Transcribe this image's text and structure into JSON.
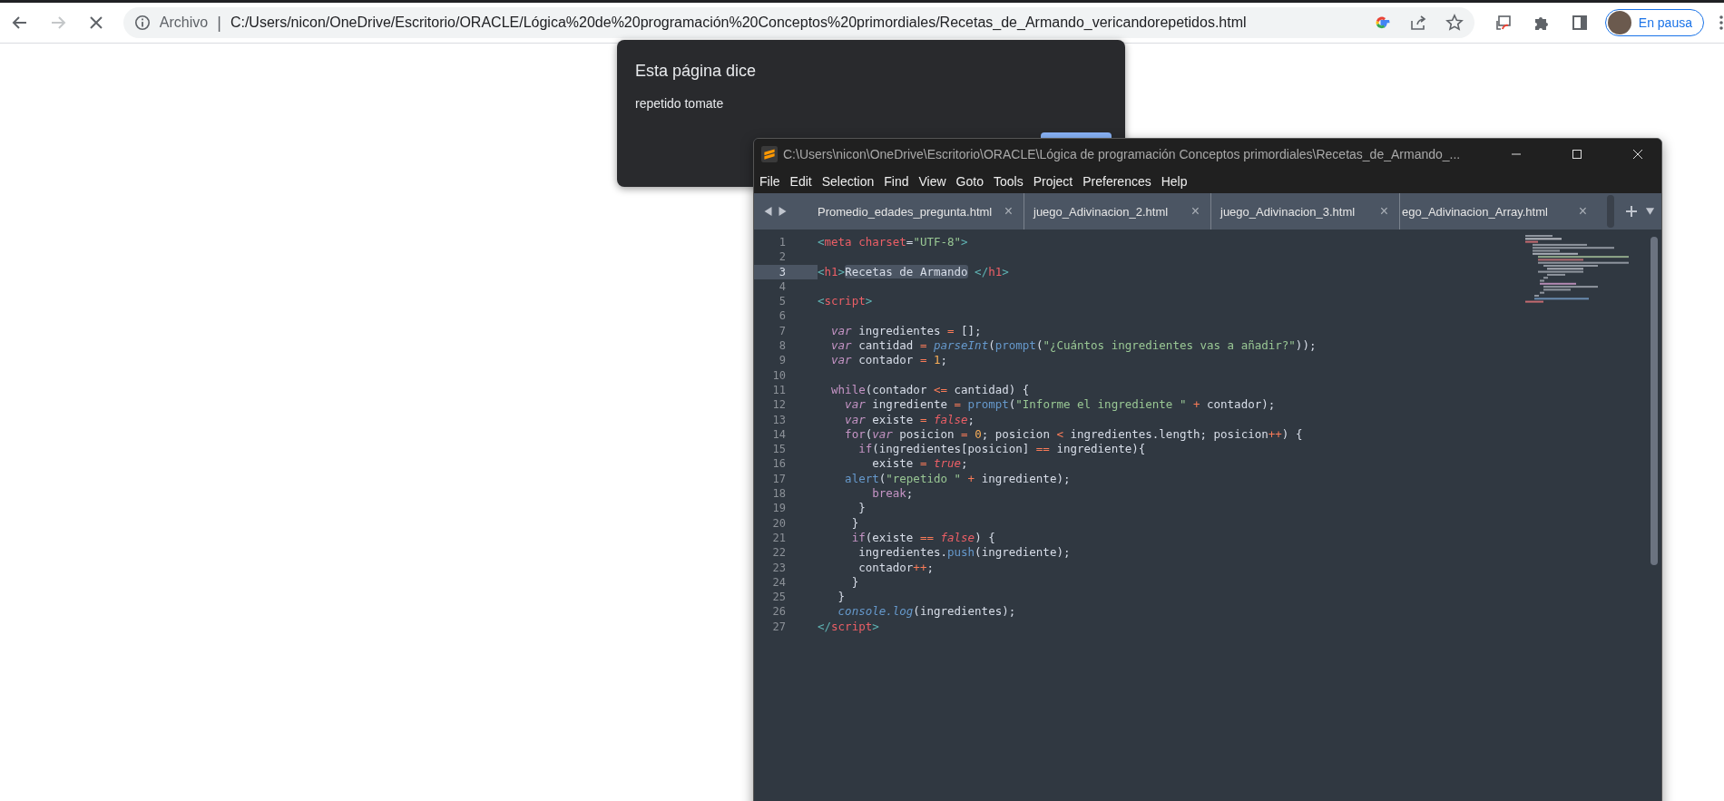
{
  "browser": {
    "forward_disabled": true,
    "omnibox": {
      "security_label": "Archivo",
      "separator": "|",
      "url": "C:/Users/nicon/OneDrive/Escritorio/ORACLE/Lógica%20de%20programación%20Conceptos%20primordiales/Recetas_de_Armando_vericandorepetidos.html"
    },
    "profile": {
      "label": "En pausa"
    }
  },
  "dialog": {
    "title": "Esta página dice",
    "message": "repetido tomate"
  },
  "editor": {
    "title": "C:\\Users\\nicon\\OneDrive\\Escritorio\\ORACLE\\Lógica de programación Conceptos primordiales\\Recetas_de_Armando_...",
    "menu": [
      "File",
      "Edit",
      "Selection",
      "Find",
      "View",
      "Goto",
      "Tools",
      "Project",
      "Preferences",
      "Help"
    ],
    "tabs": [
      {
        "label": "Promedio_edades_pregunta.html",
        "close": "×",
        "selected": false
      },
      {
        "label": "juego_Adivinacion_2.html",
        "close": "×",
        "selected": false
      },
      {
        "label": "juego_Adivinacion_3.html",
        "close": "×",
        "selected": false
      },
      {
        "label": "ego_Adivinacion_Array.html",
        "close": "×",
        "selected": false
      }
    ],
    "lines": [
      {
        "number": "1",
        "current": false,
        "tokens": [
          {
            "text": "<",
            "kind": "punct"
          },
          {
            "text": "meta",
            "kind": "tag"
          },
          {
            "text": " charset",
            "kind": "tag"
          },
          {
            "text": "=",
            "kind": "plain"
          },
          {
            "text": "\"UTF-8\"",
            "kind": "string"
          },
          {
            "text": ">",
            "kind": "punct"
          }
        ]
      },
      {
        "number": "2",
        "current": false
      },
      {
        "number": "3",
        "current": true,
        "tokens": [
          {
            "text": "<",
            "kind": "punct"
          },
          {
            "text": "h1",
            "kind": "tag"
          },
          {
            "text": ">",
            "kind": "punct"
          },
          {
            "text": "Recetas de Armando",
            "kind": "selection"
          },
          {
            "text": " </",
            "kind": "punct"
          },
          {
            "text": "h1",
            "kind": "tag"
          },
          {
            "text": ">",
            "kind": "punct"
          }
        ]
      },
      {
        "number": "4",
        "current": false
      },
      {
        "number": "5",
        "current": false,
        "tokens": [
          {
            "text": "<",
            "kind": "punct"
          },
          {
            "text": "script",
            "kind": "tag"
          },
          {
            "text": ">",
            "kind": "punct"
          }
        ]
      },
      {
        "number": "6",
        "current": false
      },
      {
        "number": "7",
        "current": false,
        "tokens": [
          {
            "text": "  var",
            "kind": "storage"
          },
          {
            "text": " ingredientes ",
            "kind": "plain"
          },
          {
            "text": "=",
            "kind": "op"
          },
          {
            "text": " [];",
            "kind": "plain"
          }
        ]
      },
      {
        "number": "8",
        "current": false,
        "tokens": [
          {
            "text": "  var",
            "kind": "storage"
          },
          {
            "text": " cantidad ",
            "kind": "plain"
          },
          {
            "text": "= ",
            "kind": "op"
          },
          {
            "text": "parseInt",
            "kind": "func-italic"
          },
          {
            "text": "(",
            "kind": "plain"
          },
          {
            "text": "prompt",
            "kind": "func"
          },
          {
            "text": "(",
            "kind": "plain"
          },
          {
            "text": "\"¿Cuántos ingredientes vas a añadir?\"",
            "kind": "string"
          },
          {
            "text": "));",
            "kind": "plain"
          }
        ]
      },
      {
        "number": "9",
        "current": false,
        "tokens": [
          {
            "text": "  var",
            "kind": "storage"
          },
          {
            "text": " contador ",
            "kind": "plain"
          },
          {
            "text": "= ",
            "kind": "op"
          },
          {
            "text": "1",
            "kind": "number"
          },
          {
            "text": ";",
            "kind": "plain"
          }
        ]
      },
      {
        "number": "10",
        "current": false
      },
      {
        "number": "11",
        "current": false,
        "tokens": [
          {
            "text": "  while",
            "kind": "keyword"
          },
          {
            "text": "(contador ",
            "kind": "plain"
          },
          {
            "text": "<=",
            "kind": "op"
          },
          {
            "text": " cantidad) {",
            "kind": "plain"
          }
        ]
      },
      {
        "number": "12",
        "current": false,
        "tokens": [
          {
            "text": "    var",
            "kind": "storage"
          },
          {
            "text": " ingrediente ",
            "kind": "plain"
          },
          {
            "text": "= ",
            "kind": "op"
          },
          {
            "text": "prompt",
            "kind": "func"
          },
          {
            "text": "(",
            "kind": "plain"
          },
          {
            "text": "\"Informe el ingrediente \" ",
            "kind": "string"
          },
          {
            "text": "+",
            "kind": "op"
          },
          {
            "text": " contador);",
            "kind": "plain"
          }
        ]
      },
      {
        "number": "13",
        "current": false,
        "tokens": [
          {
            "text": "    var",
            "kind": "storage"
          },
          {
            "text": " existe ",
            "kind": "plain"
          },
          {
            "text": "= ",
            "kind": "op"
          },
          {
            "text": "false",
            "kind": "constant"
          },
          {
            "text": ";",
            "kind": "plain"
          }
        ]
      },
      {
        "number": "14",
        "current": false,
        "tokens": [
          {
            "text": "    for",
            "kind": "keyword"
          },
          {
            "text": "(",
            "kind": "plain"
          },
          {
            "text": "var",
            "kind": "storage"
          },
          {
            "text": " posicion ",
            "kind": "plain"
          },
          {
            "text": "= ",
            "kind": "op"
          },
          {
            "text": "0",
            "kind": "number"
          },
          {
            "text": "; posicion ",
            "kind": "plain"
          },
          {
            "text": "<",
            "kind": "op"
          },
          {
            "text": " ingredientes.length; posicion",
            "kind": "plain"
          },
          {
            "text": "++",
            "kind": "op"
          },
          {
            "text": ") {",
            "kind": "plain"
          }
        ]
      },
      {
        "number": "15",
        "current": false,
        "tokens": [
          {
            "text": "      if",
            "kind": "keyword"
          },
          {
            "text": "(ingredientes[posicion] ",
            "kind": "plain"
          },
          {
            "text": "==",
            "kind": "op"
          },
          {
            "text": " ingrediente){",
            "kind": "plain"
          }
        ]
      },
      {
        "number": "16",
        "current": false,
        "tokens": [
          {
            "text": "        existe ",
            "kind": "plain"
          },
          {
            "text": "= ",
            "kind": "op"
          },
          {
            "text": "true",
            "kind": "constant"
          },
          {
            "text": ";",
            "kind": "plain"
          }
        ]
      },
      {
        "number": "17",
        "current": false,
        "tokens": [
          {
            "text": "    alert",
            "kind": "func"
          },
          {
            "text": "(",
            "kind": "plain"
          },
          {
            "text": "\"repetido \" ",
            "kind": "string"
          },
          {
            "text": "+",
            "kind": "op"
          },
          {
            "text": " ingrediente);",
            "kind": "plain"
          }
        ]
      },
      {
        "number": "18",
        "current": false,
        "tokens": [
          {
            "text": "        break",
            "kind": "keyword"
          },
          {
            "text": ";",
            "kind": "plain"
          }
        ]
      },
      {
        "number": "19",
        "current": false,
        "tokens": [
          {
            "text": "      }",
            "kind": "plain"
          }
        ]
      },
      {
        "number": "20",
        "current": false,
        "tokens": [
          {
            "text": "     }",
            "kind": "plain"
          }
        ]
      },
      {
        "number": "21",
        "current": false,
        "tokens": [
          {
            "text": "     if",
            "kind": "keyword"
          },
          {
            "text": "(existe ",
            "kind": "plain"
          },
          {
            "text": "== ",
            "kind": "op"
          },
          {
            "text": "false",
            "kind": "constant"
          },
          {
            "text": ") {",
            "kind": "plain"
          }
        ]
      },
      {
        "number": "22",
        "current": false,
        "tokens": [
          {
            "text": "      ingredientes.",
            "kind": "plain"
          },
          {
            "text": "push",
            "kind": "func"
          },
          {
            "text": "(ingrediente);",
            "kind": "plain"
          }
        ]
      },
      {
        "number": "23",
        "current": false,
        "tokens": [
          {
            "text": "      contador",
            "kind": "plain"
          },
          {
            "text": "++",
            "kind": "op"
          },
          {
            "text": ";",
            "kind": "plain"
          }
        ]
      },
      {
        "number": "24",
        "current": false,
        "tokens": [
          {
            "text": "     }",
            "kind": "plain"
          }
        ]
      },
      {
        "number": "25",
        "current": false,
        "tokens": [
          {
            "text": "   }",
            "kind": "plain"
          }
        ]
      },
      {
        "number": "26",
        "current": false,
        "tokens": [
          {
            "text": "   console.log",
            "kind": "func-italic"
          },
          {
            "text": "(ingredientes);",
            "kind": "plain"
          }
        ]
      },
      {
        "number": "27",
        "current": false,
        "tokens": [
          {
            "text": "</",
            "kind": "punct"
          },
          {
            "text": "script",
            "kind": "tag"
          },
          {
            "text": ">",
            "kind": "punct"
          }
        ]
      }
    ]
  }
}
